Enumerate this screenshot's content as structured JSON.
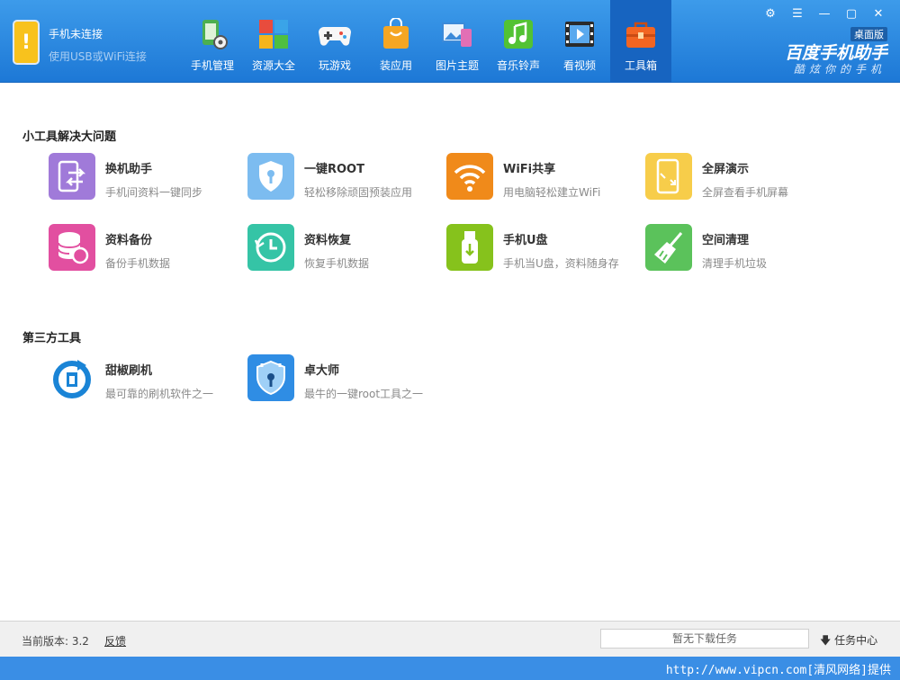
{
  "status": {
    "title": "手机未连接",
    "subtitle": "使用USB或WiFi连接"
  },
  "nav": [
    {
      "label": "手机管理",
      "icon": "phone-manage-icon",
      "color": "#4caf50"
    },
    {
      "label": "资源大全",
      "icon": "resource-grid-icon",
      "color": "#f39c12"
    },
    {
      "label": "玩游戏",
      "icon": "gamepad-icon",
      "color": "#ffffff"
    },
    {
      "label": "装应用",
      "icon": "shopping-bag-icon",
      "color": "#f5a623"
    },
    {
      "label": "图片主题",
      "icon": "picture-icon",
      "color": "#e26fb5"
    },
    {
      "label": "音乐铃声",
      "icon": "music-note-icon",
      "color": "#52c234"
    },
    {
      "label": "看视频",
      "icon": "film-icon",
      "color": "#3b8ad9"
    },
    {
      "label": "工具箱",
      "icon": "toolbox-icon",
      "color": "#f26522",
      "active": true
    }
  ],
  "window": {
    "edition": "桌面版",
    "brand": "百度手机助手",
    "slogan": "酷炫你的手机"
  },
  "sections": {
    "small_tools_title": "小工具解决大问题",
    "third_party_title": "第三方工具"
  },
  "tools": [
    {
      "name": "换机助手",
      "desc": "手机间资料一键同步",
      "icon": "phone-transfer-icon",
      "color": "#a07ad9"
    },
    {
      "name": "一键ROOT",
      "desc": "轻松移除顽固预装应用",
      "icon": "shield-key-icon",
      "color": "#7cbcf0"
    },
    {
      "name": "WiFi共享",
      "desc": "用电脑轻松建立WiFi",
      "icon": "wifi-icon",
      "color": "#f08a1a"
    },
    {
      "name": "全屏演示",
      "desc": "全屏查看手机屏幕",
      "icon": "fullscreen-phone-icon",
      "color": "#f7cd4a"
    },
    {
      "name": "资料备份",
      "desc": "备份手机数据",
      "icon": "database-backup-icon",
      "color": "#e24fa0"
    },
    {
      "name": "资料恢复",
      "desc": "恢复手机数据",
      "icon": "clock-restore-icon",
      "color": "#35c4a6"
    },
    {
      "name": "手机U盘",
      "desc": "手机当U盘，资料随身存",
      "icon": "usb-drive-icon",
      "color": "#86c21c"
    },
    {
      "name": "空间清理",
      "desc": "清理手机垃圾",
      "icon": "broom-icon",
      "color": "#5bc25b"
    }
  ],
  "third_party": [
    {
      "name": "甜椒刷机",
      "desc": "最可靠的刷机软件之一",
      "icon": "tianjiao-logo-icon",
      "color": "#1a84d6"
    },
    {
      "name": "卓大师",
      "desc": "最牛的一键root工具之一",
      "icon": "zhuodashi-shield-icon",
      "color": "#2f8de4"
    }
  ],
  "footer": {
    "version": "当前版本: 3.2",
    "feedback": "反馈",
    "download_status": "暂无下载任务",
    "task_center": "任务中心",
    "watermark": "http://www.vipcn.com[清风网络]提供"
  }
}
